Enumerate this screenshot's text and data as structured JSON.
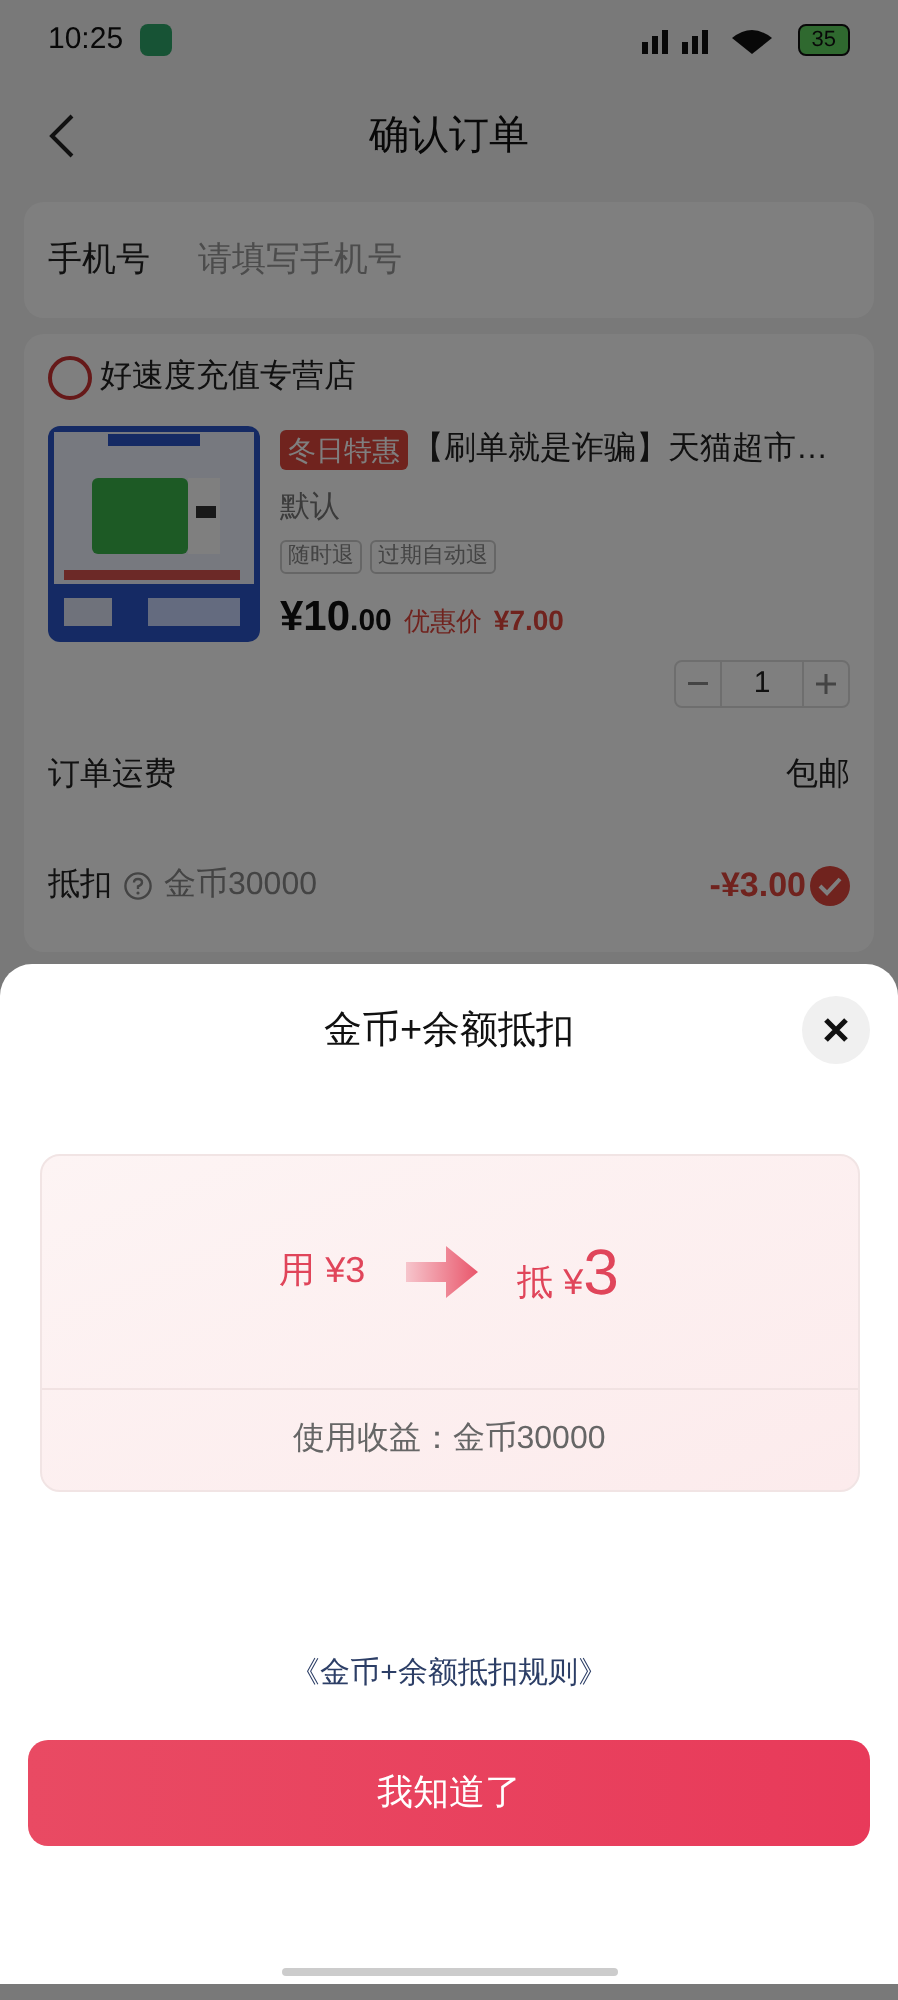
{
  "status_bar": {
    "time": "10:25",
    "battery": "35"
  },
  "header": {
    "title": "确认订单"
  },
  "phone_field": {
    "label": "手机号",
    "placeholder": "请填写手机号"
  },
  "store": {
    "name": "好速度充值专营店",
    "product": {
      "badge": "冬日特惠",
      "title": "【刷单就是诈骗】天猫超市…",
      "variant": "默认",
      "tags": [
        "随时退",
        "过期自动退"
      ],
      "price_main": "¥10",
      "price_cents": ".00",
      "discount_label": "优惠价",
      "discount_price": "¥7.00",
      "quantity": "1"
    }
  },
  "shipping": {
    "label": "订单运费",
    "value": "包邮"
  },
  "deduction": {
    "label": "抵扣",
    "coins": "金币30000",
    "amount": "-¥3.00",
    "checked": true
  },
  "sheet": {
    "title": "金币+余额抵扣",
    "use_label": "用",
    "use_amount": "¥3",
    "offset_label": "抵",
    "offset_currency": "¥",
    "offset_amount": "3",
    "usage": "使用收益：金币30000",
    "rules_link": "《金币+余额抵扣规则》",
    "confirm_button": "我知道了"
  }
}
